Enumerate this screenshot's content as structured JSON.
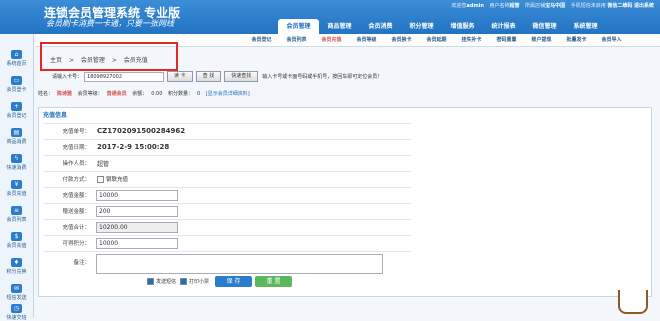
{
  "header": {
    "title": "连锁会员管理系统 专业版",
    "slogan": "会员刷卡消费一卡通，只要一张网线",
    "topbar": {
      "welcome": "欢迎您",
      "user": "admin",
      "user_label": "用户名称",
      "user_role": "超管",
      "store_label": "所属店铺",
      "store": "宝马中国",
      "sms": "手机短信未启用",
      "wechat": "微信二维码",
      "logout": "退出系统"
    },
    "nav": [
      "会员管理",
      "商品管理",
      "会员消费",
      "积分管理",
      "增值服务",
      "统计报表",
      "微信管理",
      "系统管理"
    ],
    "active_nav": 0
  },
  "subnav": [
    "会员登记",
    "会员列表",
    "会员充值",
    "会员等级",
    "会员换卡",
    "会员延期",
    "挂失补卡",
    "密码重置",
    "账户提现",
    "批量发卡",
    "会员导入"
  ],
  "sidebar": [
    {
      "label": "系统首页",
      "icon": "home-icon"
    },
    {
      "label": "会员登卡",
      "icon": "card-icon"
    },
    {
      "label": "会员登记",
      "icon": "user-add-icon"
    },
    {
      "label": "商品消费",
      "icon": "cart-icon"
    },
    {
      "label": "快速消费",
      "icon": "lightning-icon"
    },
    {
      "label": "会员充值",
      "icon": "wallet-icon"
    },
    {
      "label": "会员列表",
      "icon": "list-icon"
    },
    {
      "label": "会员充值",
      "icon": "coin-icon"
    },
    {
      "label": "积分兑换",
      "icon": "gift-icon"
    },
    {
      "label": "短信发送",
      "icon": "sms-icon"
    },
    {
      "label": "快速交班",
      "icon": "clock-icon"
    }
  ],
  "breadcrumb": [
    "主页",
    ">",
    "会员管理",
    ">",
    "会员充值"
  ],
  "scan": {
    "label": "请输入卡号：",
    "value": "18098927002",
    "read_card": "读 卡",
    "search": "查 找",
    "quick_search": "快速查找",
    "hint": "输入卡号或卡面号码或手机号，按回车即可定位会员！"
  },
  "member": {
    "name_label": "姓名：",
    "name": "陈诗雅",
    "level_label": "会员等级：",
    "level": "普通会员",
    "balance_label": "余额：",
    "balance": "0.00",
    "points_label": "积分数量：",
    "points": "0",
    "detail_link": "[显示会员详细资料]"
  },
  "panel": {
    "title": "充值信息",
    "order_label": "充值单号：",
    "order_no": "CZ1702091500284962",
    "date_label": "充值日期：",
    "date": "2017-2-9 15:00:28",
    "operator_label": "操作人员：",
    "operator": "超管",
    "pay_label": "付款方式：",
    "pay_option": "银联充值",
    "amount_label": "充值金额：",
    "amount": "10000",
    "gift_label": "赠送金额：",
    "gift": "200",
    "total_label": "充值合计：",
    "total": "10200.00",
    "points_label": "可得积分：",
    "points": "10000",
    "note_label": "备注：",
    "sms_check": "发送短信",
    "print_check": "打印小票",
    "save": "保 存",
    "reset": "重 置"
  }
}
